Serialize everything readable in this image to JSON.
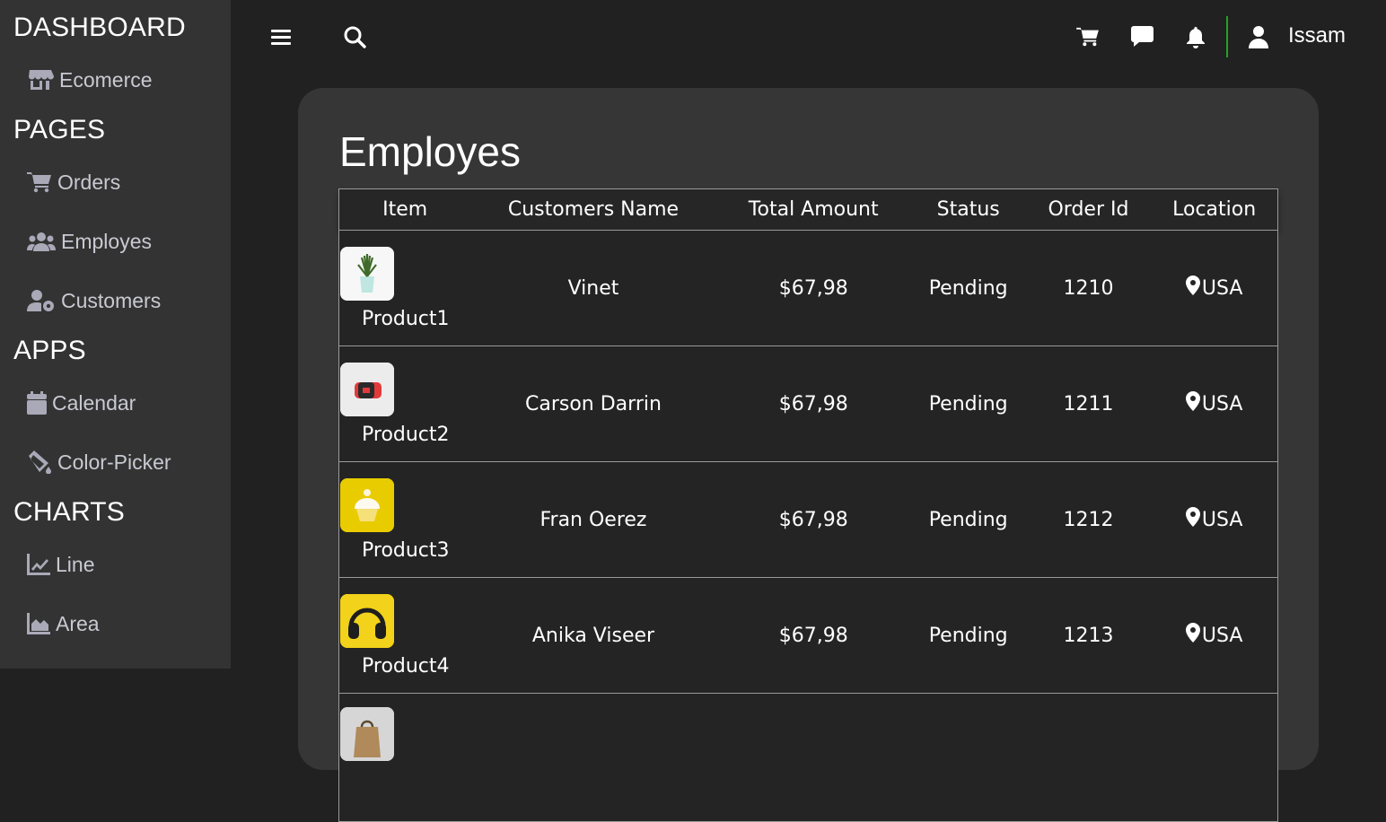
{
  "sidebar": {
    "sections": [
      {
        "title": "DASHBOARD",
        "items": [
          {
            "label": "Ecomerce",
            "icon": "store-icon"
          }
        ]
      },
      {
        "title": "PAGES",
        "items": [
          {
            "label": "Orders",
            "icon": "cart-icon"
          },
          {
            "label": "Employes",
            "icon": "users-icon"
          },
          {
            "label": "Customers",
            "icon": "user-cog-icon"
          }
        ]
      },
      {
        "title": "APPS",
        "items": [
          {
            "label": "Calendar",
            "icon": "calendar-icon"
          },
          {
            "label": "Color-Picker",
            "icon": "paint-bucket-icon"
          }
        ]
      },
      {
        "title": "CHARTS",
        "items": [
          {
            "label": "Line",
            "icon": "line-chart-icon"
          },
          {
            "label": "Area",
            "icon": "area-chart-icon"
          }
        ]
      }
    ]
  },
  "topbar": {
    "icons": [
      "menu-icon",
      "search-icon",
      "cart-icon",
      "chat-icon",
      "bell-icon",
      "user-icon"
    ],
    "username": "Issam",
    "divider_color": "#22a322"
  },
  "page": {
    "title": "Employes"
  },
  "table": {
    "headers": [
      "Item",
      "Customers Name",
      "Total Amount",
      "Status",
      "Order Id",
      "Location"
    ],
    "rows": [
      {
        "item": "Product1",
        "image": "plant",
        "customer": "Vinet",
        "amount": "$67,98",
        "status": "Pending",
        "order_id": "1210",
        "location": "USA"
      },
      {
        "item": "Product2",
        "image": "watch",
        "customer": "Carson Darrin",
        "amount": "$67,98",
        "status": "Pending",
        "order_id": "1211",
        "location": "USA"
      },
      {
        "item": "Product3",
        "image": "cupcake",
        "customer": "Fran Oerez",
        "amount": "$67,98",
        "status": "Pending",
        "order_id": "1212",
        "location": "USA"
      },
      {
        "item": "Product4",
        "image": "headphones",
        "customer": "Anika Viseer",
        "amount": "$67,98",
        "status": "Pending",
        "order_id": "1213",
        "location": "USA"
      }
    ]
  },
  "colors": {
    "background": "#212121",
    "sidebar": "#333333",
    "card": "#363636",
    "row": "#242424"
  }
}
